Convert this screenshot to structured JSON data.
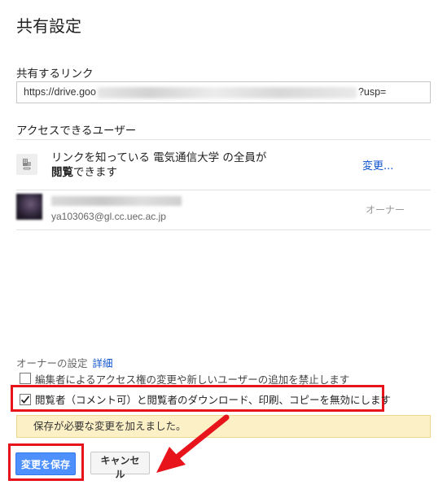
{
  "dialog": {
    "title": "共有設定",
    "link_section": {
      "label": "共有するリンク",
      "url_start": "https://drive.goo",
      "url_end": "?usp="
    },
    "access_section": {
      "label": "アクセスできるユーザー",
      "link_row": {
        "text_line1": "リンクを知っている 電気通信大学 の全員が",
        "permission_bold": "閲覧",
        "text_line2_rest": "できます",
        "change_link": "変更..."
      },
      "owner_row": {
        "email": "ya103063@gl.cc.uec.ac.jp",
        "role": "オーナー"
      }
    },
    "owner_settings": {
      "label": "オーナーの設定",
      "details_link": "詳細",
      "option1": "編集者によるアクセス権の変更や新しいユーザーの追加を禁止します",
      "option2": "閲覧者（コメント可）と閲覧者のダウンロード、印刷、コピーを無効にします",
      "option2_checked": true
    },
    "warning": "保存が必要な変更を加えました。",
    "buttons": {
      "save": "変更を保存",
      "cancel": "キャンセル"
    }
  },
  "colors": {
    "annotation_red": "#e8141c",
    "primary_blue": "#4d90fe",
    "link_blue": "#1155cc",
    "warning_bg": "#fcf0c6"
  },
  "icons": {
    "domain_icon": "building-icon",
    "checkbox_checked": "checkmark-icon",
    "annotation_arrow": "red-arrow-icon"
  }
}
